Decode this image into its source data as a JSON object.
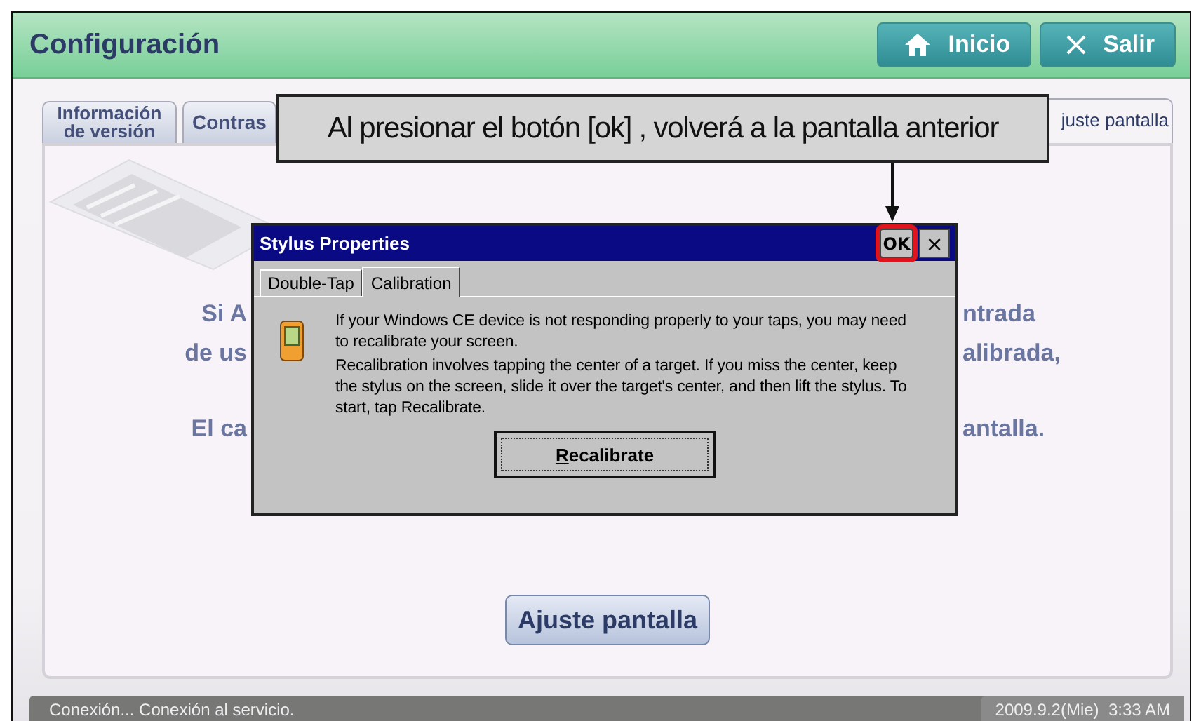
{
  "header": {
    "title": "Configuración",
    "buttons": [
      {
        "kind": "home",
        "label": "Inicio"
      },
      {
        "kind": "close",
        "label": "Salir"
      }
    ]
  },
  "tabs": [
    {
      "label": "Información de versión",
      "selected": false
    },
    {
      "label": "Contras",
      "selected": false
    },
    {
      "label": "juste pantalla",
      "selected": true
    }
  ],
  "panel": {
    "text_fragments": [
      {
        "left": "Si A",
        "right": "ntrada"
      },
      {
        "left": "de us",
        "right": "alibrada,"
      },
      {
        "left": "El ca",
        "right": "antalla."
      }
    ],
    "button": "Ajuste pantalla"
  },
  "callout": {
    "text": "Al presionar el botón [ok] , volverá a la pantalla anterior"
  },
  "dialog": {
    "title": "Stylus Properties",
    "ok": "OK",
    "ok_highlighted": true,
    "close": "×",
    "tabs": [
      {
        "label": "Double-Tap",
        "selected": false
      },
      {
        "label": "Calibration",
        "selected": true
      }
    ],
    "paragraphs": [
      "If your Windows CE device is not responding properly to your taps, you may need to recalibrate your screen.",
      "Recalibration involves tapping the center of a target. If you miss the center, keep the stylus on the screen, slide it over the target's center, and then lift the stylus. To start, tap Recalibrate."
    ],
    "button": "Recalibrate"
  },
  "status_bar": {
    "message": "Conexión... Conexión al servicio.",
    "datetime": "2009.9.2(Mie)  3:33 AM"
  }
}
